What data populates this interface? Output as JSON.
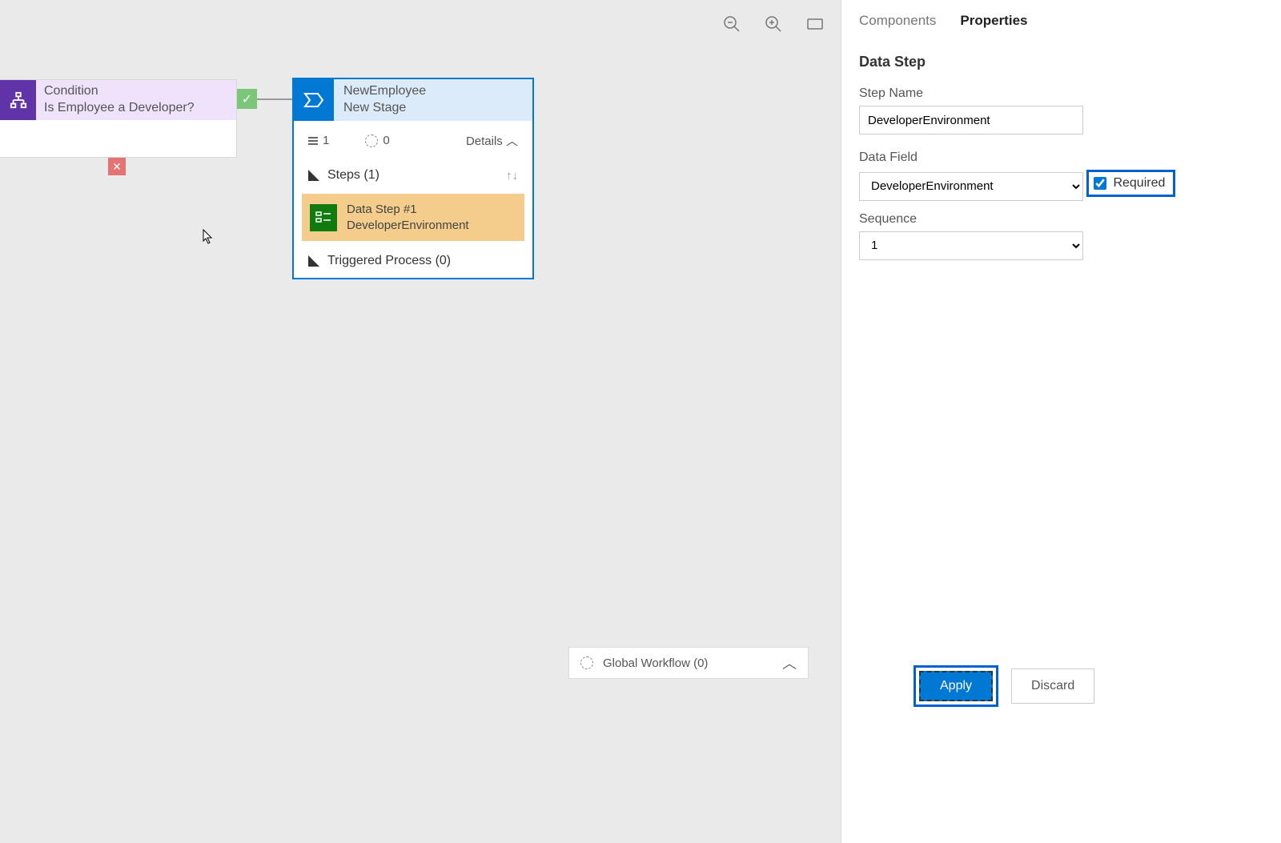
{
  "toolbar": {
    "zoom_out": "zoom-out",
    "zoom_in": "zoom-in",
    "fit": "fit-screen"
  },
  "condition": {
    "type_label": "Condition",
    "name": "Is Employee a Developer?"
  },
  "stage": {
    "title": "NewEmployee",
    "subtitle": "New Stage",
    "stat_steps": "1",
    "stat_triggers": "0",
    "details_label": "Details",
    "steps_header": "Steps (1)",
    "data_step_title": "Data Step #1",
    "data_step_name": "DeveloperEnvironment",
    "triggered_label": "Triggered Process (0)"
  },
  "panel": {
    "tabs": {
      "components": "Components",
      "properties": "Properties"
    },
    "section": "Data Step",
    "step_name_label": "Step Name",
    "step_name_value": "DeveloperEnvironment",
    "data_field_label": "Data Field",
    "data_field_value": "DeveloperEnvironment",
    "required_label": "Required",
    "sequence_label": "Sequence",
    "sequence_value": "1",
    "apply_label": "Apply",
    "discard_label": "Discard"
  },
  "global_workflow": {
    "label": "Global Workflow (0)"
  }
}
